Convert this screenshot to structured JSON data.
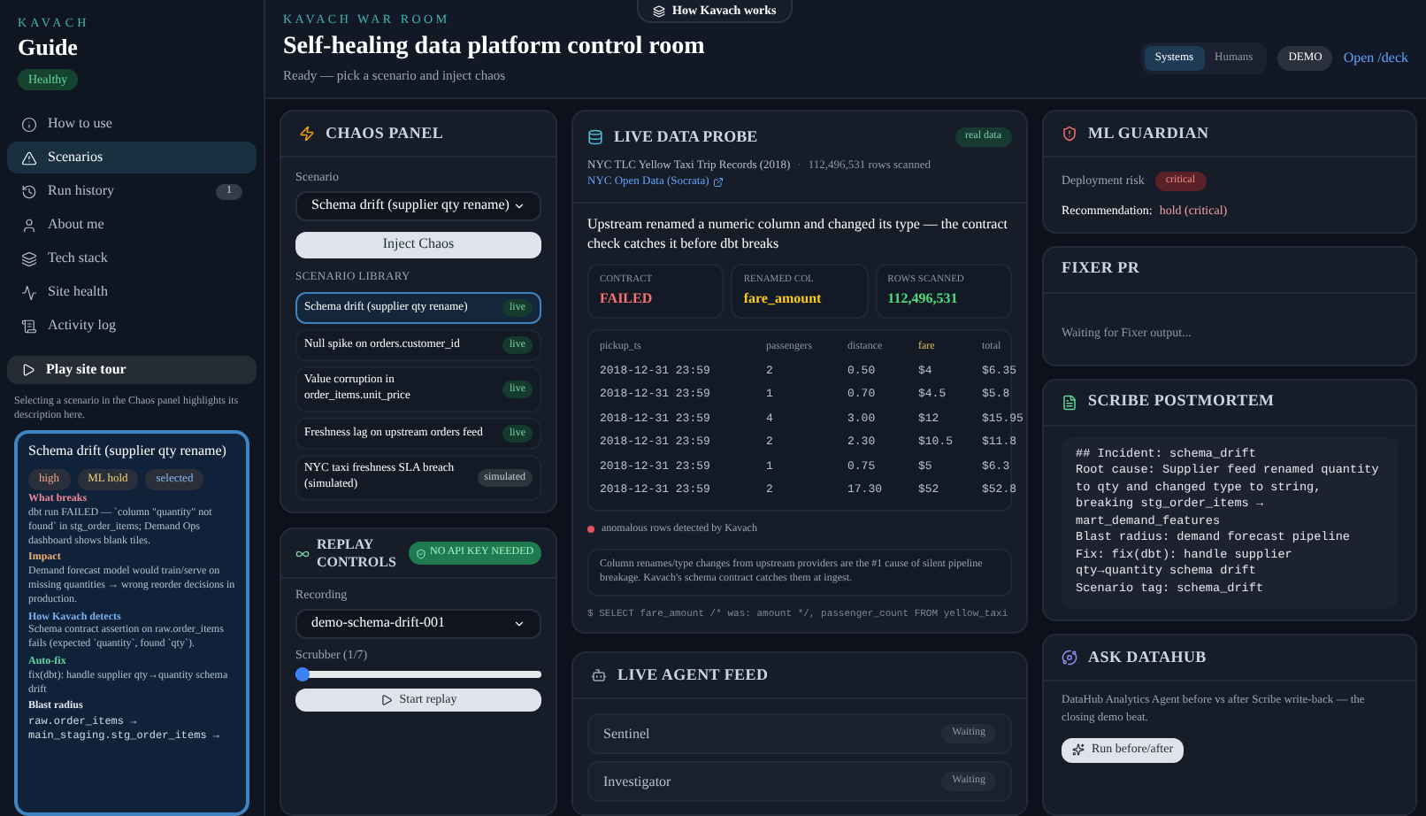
{
  "sidebar": {
    "brand": "KAVACH",
    "title": "Guide",
    "status": "Healthy",
    "items": [
      {
        "label": "How to use",
        "selected": false
      },
      {
        "label": "Scenarios",
        "selected": true
      },
      {
        "label": "Run history",
        "selected": false,
        "count": "1"
      },
      {
        "label": "About me",
        "selected": false
      },
      {
        "label": "Tech stack",
        "selected": false
      },
      {
        "label": "Site health",
        "selected": false
      },
      {
        "label": "Activity log",
        "selected": false
      }
    ],
    "tour_button": "Play site tour",
    "hint": "Selecting a scenario in the Chaos panel highlights its description here.",
    "scenario_card": {
      "title": "Schema drift (supplier qty rename)",
      "tags": [
        {
          "label": "high",
          "color": "#f0a58a"
        },
        {
          "label": "ML hold",
          "color": "#f2d27a"
        },
        {
          "label": "selected",
          "color": "#8ab8f0"
        }
      ],
      "sections": [
        {
          "kind": "text",
          "heading": "What breaks",
          "color": "#f08a9a",
          "text": "dbt run FAILED — `column \"quantity\" not found` in stg_order_items; Demand Ops dashboard shows blank tiles."
        },
        {
          "kind": "text",
          "heading": "Impact",
          "color": "#f0b070",
          "text": "Demand forecast model would train/serve on missing quantities → wrong reorder decisions in production."
        },
        {
          "kind": "text",
          "heading": "How Kavach detects",
          "color": "#7ab4f0",
          "text": "Schema contract assertion on raw.order_items fails (expected `quantity`, found `qty`)."
        },
        {
          "kind": "text",
          "heading": "Auto-fix",
          "color": "#5fd6a0",
          "text": "fix(dbt): handle supplier qty→quantity schema drift"
        },
        {
          "kind": "code",
          "heading": "Blast radius",
          "color": "#e2e8f0",
          "lines": [
            "raw.order_items →",
            "main_staging.stg_order_items →"
          ]
        }
      ]
    }
  },
  "header": {
    "eyebrow": "KAVACH WAR ROOM",
    "title": "Self-healing data platform control room",
    "subtitle": "Ready — pick a scenario and inject chaos",
    "how_button": "How Kavach works",
    "view_toggle": [
      {
        "label": "Systems",
        "selected": true
      },
      {
        "label": "Humans",
        "selected": false
      }
    ],
    "mode_badge": "DEMO",
    "deck_link": "Open /deck"
  },
  "chaos_panel": {
    "title": "CHAOS PANEL",
    "scenario_label": "Scenario",
    "scenario_value": "Schema drift (supplier qty rename)",
    "inject_button": "Inject Chaos",
    "library_label": "SCENARIO LIBRARY",
    "library": [
      {
        "name": "Schema drift (supplier qty rename)",
        "kind": "live",
        "badge": "live",
        "selected": true
      },
      {
        "name": "Null spike on orders.customer_id",
        "kind": "live",
        "badge": "live",
        "selected": false
      },
      {
        "name": "Value corruption in order_items.unit_price",
        "kind": "live",
        "badge": "live",
        "selected": false
      },
      {
        "name": "Freshness lag on upstream orders feed",
        "kind": "live",
        "badge": "live",
        "selected": false
      },
      {
        "name": "NYC taxi freshness SLA breach (simulated)",
        "kind": "simulated",
        "badge": "simulated",
        "selected": false
      }
    ]
  },
  "replay_controls": {
    "title": "REPLAY CONTROLS",
    "badge": "NO API KEY NEEDED",
    "recording_label": "Recording",
    "recording_value": "demo-schema-drift-001",
    "scrubber_label": "Scrubber (1/7)",
    "scrubber": {
      "level": 0
    },
    "start_button": "Start replay"
  },
  "live_data_probe": {
    "title": "LIVE DATA PROBE",
    "badge": "real data",
    "source": "NYC TLC Yellow Taxi Trip Records (2018)",
    "separator": "·",
    "rows_scanned": "112,496,531 rows scanned",
    "source_link": "NYC Open Data (Socrata)",
    "headline": "Upstream renamed a numeric column and changed its type — the contract check catches it before dbt breaks",
    "stats": [
      {
        "label": "CONTRACT",
        "value": "FAILED",
        "color": "#f87171"
      },
      {
        "label": "RENAMED COL",
        "value": "fare_amount",
        "color": "#facc15"
      },
      {
        "label": "ROWS SCANNED",
        "value": "112,496,531",
        "color": "#4ade80"
      }
    ],
    "table": {
      "columns": [
        {
          "label": "pickup_ts",
          "highlighted": false
        },
        {
          "label": "passengers",
          "highlighted": false
        },
        {
          "label": "distance",
          "highlighted": false
        },
        {
          "label": "fare",
          "highlighted": true
        },
        {
          "label": "total",
          "highlighted": false
        }
      ],
      "rows": [
        [
          "2018-12-31 23:59",
          "2",
          "0.50",
          "$4",
          "$6.35"
        ],
        [
          "2018-12-31 23:59",
          "1",
          "0.70",
          "$4.5",
          "$5.8"
        ],
        [
          "2018-12-31 23:59",
          "4",
          "3.00",
          "$12",
          "$15.95"
        ],
        [
          "2018-12-31 23:59",
          "2",
          "2.30",
          "$10.5",
          "$11.8"
        ],
        [
          "2018-12-31 23:59",
          "1",
          "0.75",
          "$5",
          "$6.3"
        ],
        [
          "2018-12-31 23:59",
          "2",
          "17.30",
          "$52",
          "$52.8"
        ]
      ]
    },
    "legend": {
      "text": "anomalous rows detected by Kavach",
      "color": "#e05560"
    },
    "note": "Column renames/type changes from upstream providers are the #1 cause of silent pipeline breakage. Kavach's schema contract catches them at ingest.",
    "query": "$ SELECT fare_amount /* was: amount */, passenger_count FROM yellow_taxi"
  },
  "live_agent_feed": {
    "title": "LIVE AGENT FEED",
    "agents": [
      {
        "name": "Sentinel",
        "status": "Waiting"
      },
      {
        "name": "Investigator",
        "status": "Waiting"
      }
    ]
  },
  "ml_guardian": {
    "title": "ML GUARDIAN",
    "risk_label": "Deployment risk",
    "risk_badge": "critical",
    "recommendation_label": "Recommendation:",
    "recommendation_value": "hold (critical)"
  },
  "fixer_pr": {
    "title": "FIXER PR",
    "status": "Waiting for Fixer output..."
  },
  "scribe_postmortem": {
    "title": "SCRIBE POSTMORTEM",
    "lines": [
      "## Incident: schema_drift",
      "Root cause: Supplier feed renamed quantity to qty and changed type to string, breaking stg_order_items → mart_demand_features",
      "Blast radius: demand forecast pipeline",
      "Fix: fix(dbt): handle supplier qty→quantity schema drift",
      "Scenario tag: schema_drift"
    ]
  },
  "ask_datahub": {
    "title": "ASK DATAHUB",
    "text": "DataHub Analytics Agent before vs after Scribe write-back — the closing demo beat.",
    "button": "Run before/after"
  }
}
